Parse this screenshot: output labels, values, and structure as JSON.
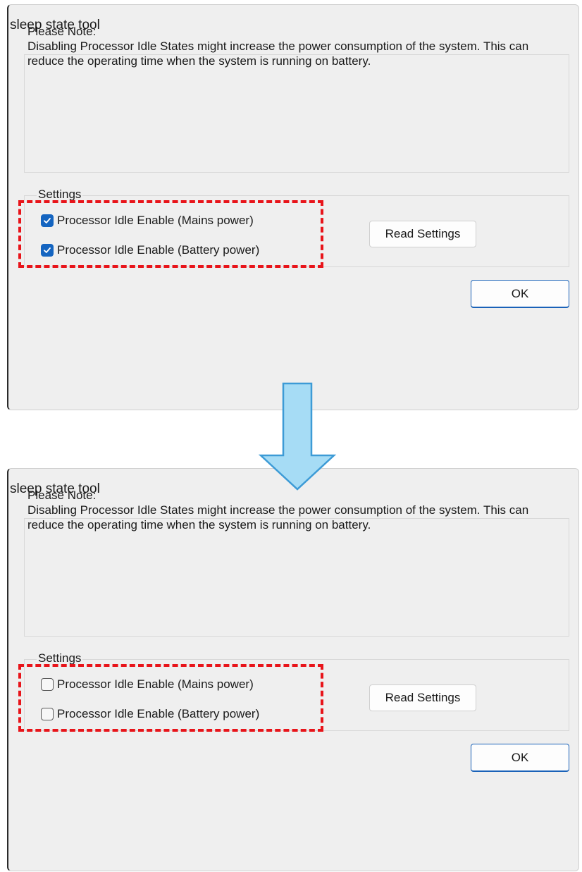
{
  "panels": [
    {
      "title": "sleep state tool",
      "note_title": "Please Note:",
      "note_text": "Disabling Processor Idle States might increase the power consumption of the system. This can reduce the operating time when the system is running on battery.",
      "settings_label": "Settings",
      "checkboxes": [
        {
          "label": "Processor Idle Enable (Mains power)",
          "checked": true
        },
        {
          "label": "Processor Idle Enable (Battery power)",
          "checked": true
        }
      ],
      "read_button": "Read Settings",
      "ok_button": "OK"
    },
    {
      "title": "sleep state tool",
      "note_title": "Please Note:",
      "note_text": "Disabling Processor Idle States might increase the power consumption of the system. This can reduce the operating time when the system is running on battery.",
      "settings_label": "Settings",
      "checkboxes": [
        {
          "label": "Processor Idle Enable (Mains power)",
          "checked": false
        },
        {
          "label": "Processor Idle Enable (Battery power)",
          "checked": false
        }
      ],
      "read_button": "Read Settings",
      "ok_button": "OK"
    }
  ],
  "colors": {
    "checkbox_checked": "#1464c0",
    "highlight_border": "#e8141a",
    "arrow_fill": "#a6dcf5",
    "arrow_stroke": "#3d9bd6"
  },
  "icons": {
    "checkmark": "checkmark-icon",
    "arrow": "down-arrow-icon"
  }
}
